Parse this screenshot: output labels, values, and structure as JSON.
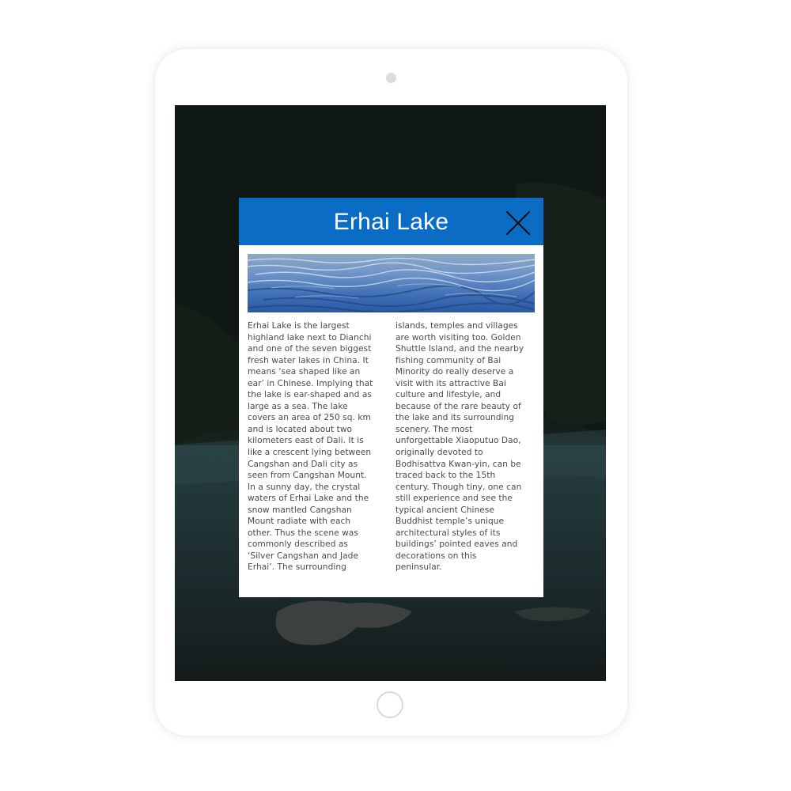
{
  "modal": {
    "title": "Erhai Lake",
    "close_icon": "close-icon",
    "image_alt": "lake-water-image",
    "article": {
      "column_left": "   Erhai Lake is the largest\nhighland lake next to Dianchi\nand one of the seven biggest\nfresh water lakes in China. It\nmeans ‘sea shaped like an\near’ in Chinese. Implying that\nthe lake is ear-shaped and as\nlarge as a sea. The lake\ncovers an area of 250 sq. km\nand is located about two\nkilometers east of Dali. It is\nlike a crescent lying between\nCangshan and Dali city as\nseen from Cangshan Mount.\nIn a sunny day, the crystal\nwaters of Erhai Lake and the\nsnow mantled Cangshan\nMount radiate with each\nother. Thus the scene was\ncommonly described as\n‘Silver Cangshan and Jade\nErhai’. The surrounding",
      "column_right": "islands, temples and villages\nare worth visiting too. Golden\nShuttle Island, and the nearby\nfishing community of Bai\nMinority do really deserve a\nvisit with its attractive Bai\nculture and lifestyle, and\nbecause of the rare beauty of\nthe lake and its surrounding\nscenery. The most\nunforgettable Xiaoputuo Dao,\noriginally devoted to\nBodhisattva Kwan-yin, can be\ntraced back to the 15th\ncentury. Though tiny, one can\nstill experience and see the\ntypical ancient Chinese\nBuddhist temple’s unique\narchitectural styles of its\nbuildings’ pointed eaves and\ndecorations on this\npeninsular."
    }
  },
  "colors": {
    "header_bg": "#0a6cc4",
    "title_text": "#ffffff",
    "body_text": "#4a4a4a",
    "device_frame": "#ffffff"
  }
}
